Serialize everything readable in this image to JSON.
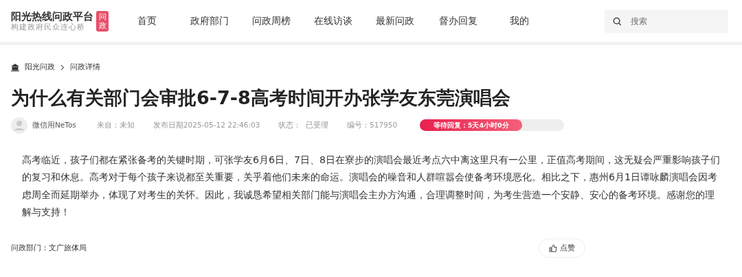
{
  "logo": {
    "title": "阳光热线问政平台",
    "subtitle": "构建政府民众连心桥",
    "badge": "问政"
  },
  "nav": [
    {
      "label": "首页",
      "selected": false
    },
    {
      "label": "政府部门",
      "selected": false
    },
    {
      "label": "问政周榜",
      "selected": false
    },
    {
      "label": "在线访谈",
      "selected": false
    },
    {
      "label": "最新问政",
      "selected": false
    },
    {
      "label": "督办回复",
      "selected": false
    },
    {
      "label": "我的",
      "selected": false
    }
  ],
  "search": {
    "placeholder": "搜索"
  },
  "breadcrumb": [
    "阳光问政",
    "问政详情"
  ],
  "title": "为什么有关部门会审批6-7-8高考时间开办张学友东莞演唱会",
  "meta": {
    "author": "微信用NeTos",
    "source": "来自：未知",
    "date": "发布日期2025-05-12 22:46:03",
    "status": "状态：  已受理",
    "number": "编号：517950"
  },
  "waiting": {
    "label": "等待回复：5天4小时0分",
    "level": 0.71
  },
  "body": "高考临近，孩子们都在紧张备考的关键时期，可张学友6月6日、7日、8日在寮步的演唱会最近考点六中离这里只有一公里，正值高考期间，这无疑会严重影响孩子们的复习和休息。高考对于每个孩子来说都至关重要，关乎着他们未来的命运。演唱会的噪音和人群喧嚣会使备考环境恶化。相比之下，惠州6月1日谭咏麟演唱会因考虑周全而延期举办，体现了对考生的关怀。因此，我诚恳希望相关部门能与演唱会主办方沟通，合理调整时间，为考生营造一个安静、安心的备考环境。感谢您的理解与支持！",
  "department": "问政部门：文广旅体局",
  "like_button": "点赞"
}
